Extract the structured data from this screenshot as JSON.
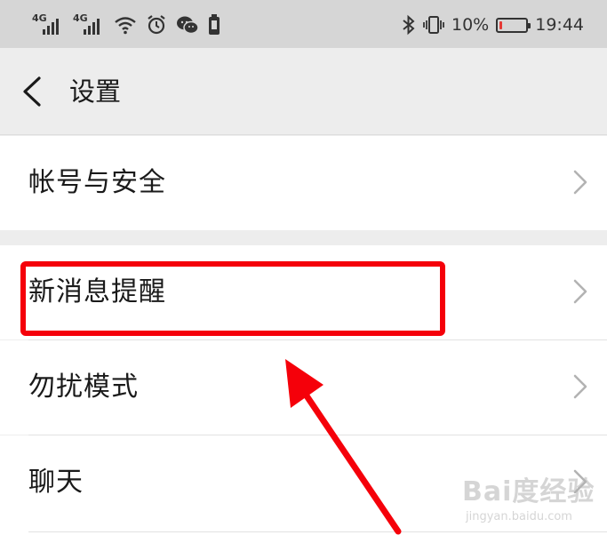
{
  "status_bar": {
    "signal_1_label": "4G",
    "signal_2_label": "4G",
    "battery_percent": "10%",
    "battery_level": 0.1,
    "time": "19:44",
    "icons": [
      "signal-icon",
      "signal-icon",
      "wifi-icon",
      "alarm-icon",
      "wechat-icon",
      "phone-icon",
      "bluetooth-icon",
      "vibrate-icon",
      "battery-icon"
    ]
  },
  "nav": {
    "back_icon": "back-icon",
    "title": "设置"
  },
  "settings": {
    "items": [
      {
        "label": "帐号与安全"
      },
      {
        "label": "新消息提醒"
      },
      {
        "label": "勿扰模式"
      },
      {
        "label": "聊天"
      }
    ]
  },
  "annotation": {
    "highlight_color": "#f5000a",
    "arrow_color": "#f5000a"
  },
  "watermark": {
    "logo": "Bai度经验",
    "url": "jingyan.baidu.com"
  }
}
